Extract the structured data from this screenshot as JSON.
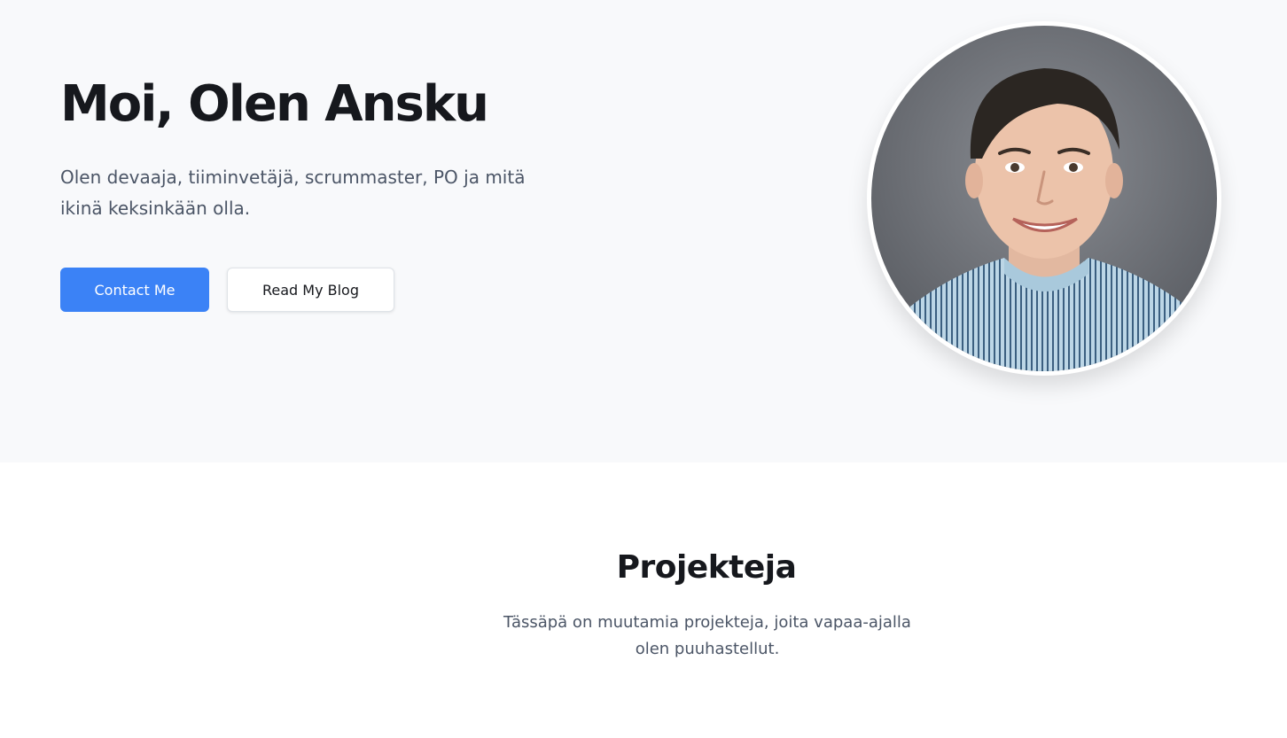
{
  "hero": {
    "title": "Moi, Olen Ansku",
    "subtitle": "Olen devaaja, tiiminvetäjä, scrummaster, PO ja mitä ikinä keksinkään olla.",
    "primary_button": "Contact Me",
    "secondary_button": "Read My Blog",
    "portrait_icon": "person-portrait-icon"
  },
  "projects": {
    "title": "Projekteja",
    "description": "Tässäpä on muutamia projekteja, joita vapaa-ajalla olen puuhastellut."
  },
  "colors": {
    "hero_background": "#f8f9fb",
    "accent": "#3b82f6",
    "heading": "#16181d",
    "body_text": "#4b5566"
  }
}
